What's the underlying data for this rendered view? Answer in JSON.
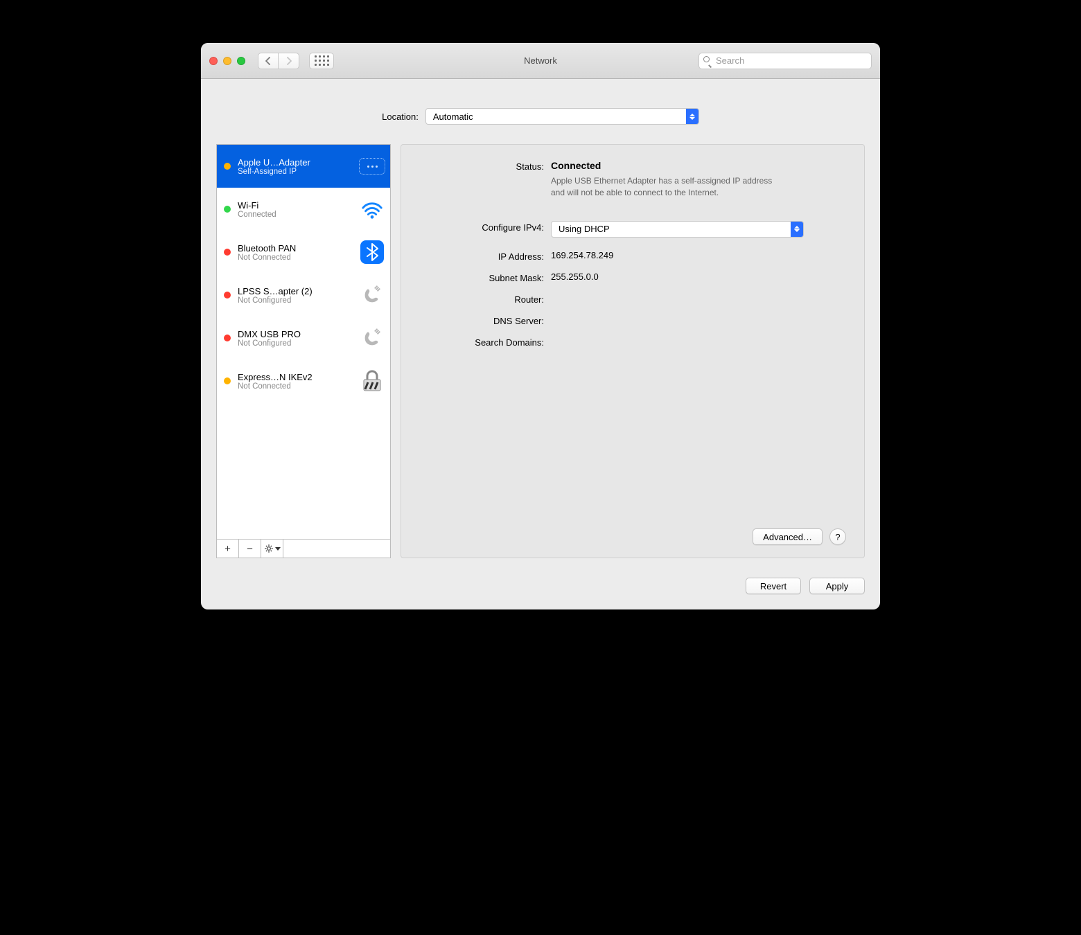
{
  "window": {
    "title": "Network"
  },
  "search": {
    "placeholder": "Search"
  },
  "location": {
    "label": "Location:",
    "value": "Automatic"
  },
  "sidebar": {
    "items": [
      {
        "name": "Apple U…Adapter",
        "status": "Self-Assigned IP",
        "dot": "orange",
        "icon": "ethernet",
        "selected": true
      },
      {
        "name": "Wi-Fi",
        "status": "Connected",
        "dot": "green",
        "icon": "wifi",
        "selected": false
      },
      {
        "name": "Bluetooth PAN",
        "status": "Not Connected",
        "dot": "red",
        "icon": "bluetooth",
        "selected": false
      },
      {
        "name": "LPSS S…apter (2)",
        "status": "Not Configured",
        "dot": "red",
        "icon": "serial",
        "selected": false
      },
      {
        "name": "DMX USB PRO",
        "status": "Not Configured",
        "dot": "red",
        "icon": "serial",
        "selected": false
      },
      {
        "name": "Express…N IKEv2",
        "status": "Not Connected",
        "dot": "orange",
        "icon": "vpn",
        "selected": false
      }
    ]
  },
  "detail": {
    "status_label": "Status:",
    "status_value": "Connected",
    "status_desc": "Apple USB Ethernet Adapter has a self-assigned IP address and will not be able to connect to the Internet.",
    "ipv4_label": "Configure IPv4:",
    "ipv4_value": "Using DHCP",
    "ip_label": "IP Address:",
    "ip_value": "169.254.78.249",
    "mask_label": "Subnet Mask:",
    "mask_value": "255.255.0.0",
    "router_label": "Router:",
    "router_value": "",
    "dns_label": "DNS Server:",
    "dns_value": "",
    "search_label": "Search Domains:",
    "search_value": "",
    "advanced_label": "Advanced…",
    "help_label": "?"
  },
  "buttons": {
    "revert": "Revert",
    "apply": "Apply"
  }
}
